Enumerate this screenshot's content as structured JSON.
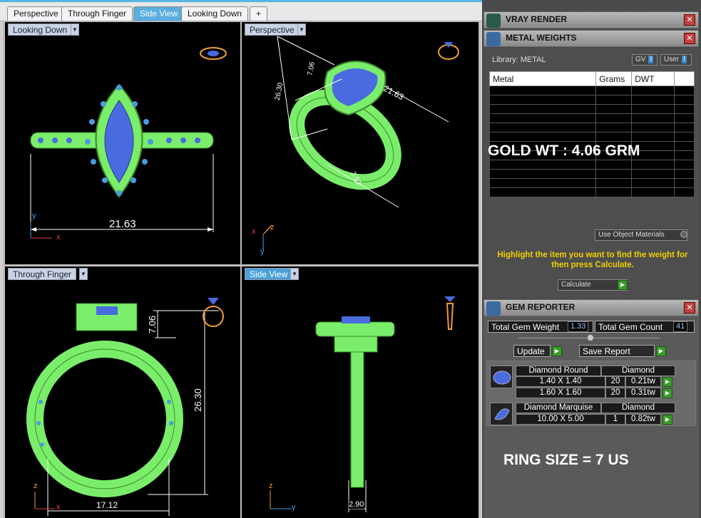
{
  "tabs": [
    "Perspective",
    "Through Finger",
    "Side View",
    "Looking Down",
    "+"
  ],
  "viewports": {
    "tl": {
      "label": "Looking Down",
      "dim": "21.63",
      "axis_x": "x",
      "axis_y": "y"
    },
    "tr": {
      "label": "Perspective",
      "dim_a": "21.63",
      "dim_b": "7.06",
      "dim_c": "26.30",
      "dim_d": "3.52",
      "axis_x": "x",
      "axis_y": "y",
      "axis_z": "z"
    },
    "bl": {
      "label": "Through Finger",
      "dim_h": "7.06",
      "dim_v": "26.30",
      "dim_w": "17.12",
      "axis_x": "x",
      "axis_z": "z"
    },
    "br": {
      "label": "Side View",
      "dim": "2.90",
      "axis_y": "y",
      "axis_z": "z"
    }
  },
  "vray": {
    "title": "VRAY RENDER"
  },
  "metal": {
    "title": "METAL WEIGHTS",
    "library": "Library: METAL",
    "gv": "GV",
    "user": "User",
    "cols": [
      "Metal",
      "Grams",
      "DWT"
    ],
    "gold_text": "GOLD WT : 4.06 GRM",
    "use_object": "Use Object Materials",
    "hint": "Highlight the item you want to find the weight for then press Calculate.",
    "calculate": "Calculate"
  },
  "gem": {
    "title": "GEM REPORTER",
    "total_weight_label": "Total Gem Weight",
    "total_weight": "1.33",
    "total_count_label": "Total Gem Count",
    "total_count": "41",
    "update": "Update",
    "save": "Save Report",
    "groups": [
      {
        "name": "Diamond Round",
        "type": "Diamond",
        "rows": [
          {
            "size": "1.40 X 1.40",
            "count": "20",
            "tw": "0.21tw"
          },
          {
            "size": "1.60 X 1.60",
            "count": "20",
            "tw": "0.31tw"
          }
        ]
      },
      {
        "name": "Diamond Marquise",
        "type": "Diamond",
        "rows": [
          {
            "size": "10.00 X 5.00",
            "count": "1",
            "tw": "0.82tw"
          }
        ]
      }
    ],
    "ring_size": "RING SIZE = 7 US"
  },
  "colors": {
    "accent": "#5aaee0",
    "ring": "#7aee6a",
    "gem": "#4a6ae0",
    "dim": "#ffffff",
    "hint": "#f0d000"
  }
}
